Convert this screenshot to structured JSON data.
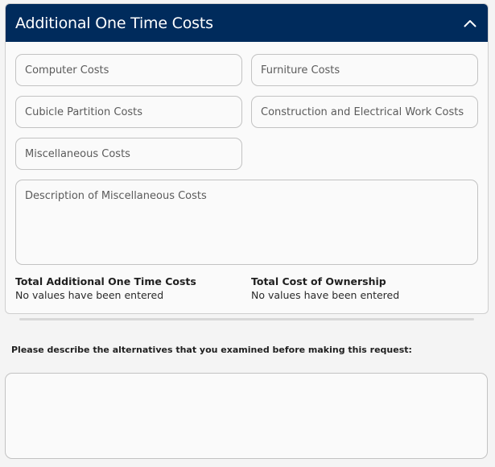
{
  "panel": {
    "title": "Additional One Time Costs",
    "collapse_icon": "chevron-up-icon",
    "header_color": "#002b5c"
  },
  "fields": {
    "computer_costs": "Computer Costs",
    "furniture_costs": "Furniture Costs",
    "cubicle_partition_costs": "Cubicle Partition Costs",
    "construction_electrical_costs": "Construction and Electrical Work Costs",
    "miscellaneous_costs": "Miscellaneous Costs",
    "misc_description": "Description of Miscellaneous Costs"
  },
  "totals": {
    "one_time_label": "Total Additional One Time Costs",
    "one_time_value": "No values have been entered",
    "ownership_label": "Total Cost of Ownership",
    "ownership_value": "No values have been entered"
  },
  "alternatives": {
    "question": "Please describe the alternatives that you examined before making this request:",
    "answer": ""
  }
}
